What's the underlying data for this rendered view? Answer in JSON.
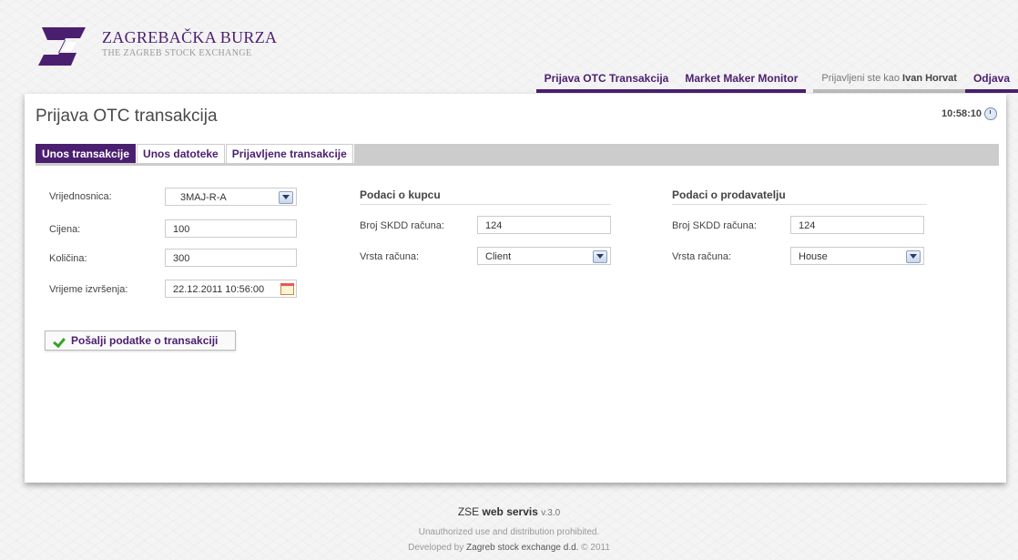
{
  "brand": {
    "name": "ZAGREBAČKA BURZA",
    "subtitle": "THE ZAGREB STOCK EXCHANGE",
    "color": "#4b1f6f"
  },
  "nav": {
    "items": [
      "Prijava OTC Transakcija",
      "Market Maker Monitor"
    ],
    "user_prefix": "Prijavljeni ste kao",
    "user_name": "Ivan Horvat",
    "logout": "Odjava"
  },
  "page": {
    "title": "Prijava OTC transakcija",
    "clock": "10:58:10"
  },
  "tabs": [
    "Unos transakcije",
    "Unos datoteke",
    "Prijavljene transakcije"
  ],
  "form": {
    "security_label": "Vrijednosnica:",
    "security_value": "3MAJ-R-A",
    "price_label": "Cijena:",
    "price_value": "100",
    "quantity_label": "Količina:",
    "quantity_value": "300",
    "time_label": "Vrijeme izvršenja:",
    "time_value": "22.12.2011 10:56:00"
  },
  "buyer": {
    "title": "Podaci o kupcu",
    "account_label": "Broj SKDD računa:",
    "account_value": "124",
    "type_label": "Vrsta računa:",
    "type_value": "Client"
  },
  "seller": {
    "title": "Podaci o prodavatelju",
    "account_label": "Broj SKDD računa:",
    "account_value": "124",
    "type_label": "Vrsta računa:",
    "type_value": "House"
  },
  "submit_label": "Pošalji podatke o transakciji",
  "footer": {
    "product_prefix": "ZSE",
    "product_name": "web servis",
    "version": "v.3.0",
    "line2": "Unauthorized use and distribution prohibited.",
    "line3_prefix": "Developed by",
    "line3_company": "Zagreb stock exchange d.d.",
    "line3_suffix": "© 2011"
  }
}
